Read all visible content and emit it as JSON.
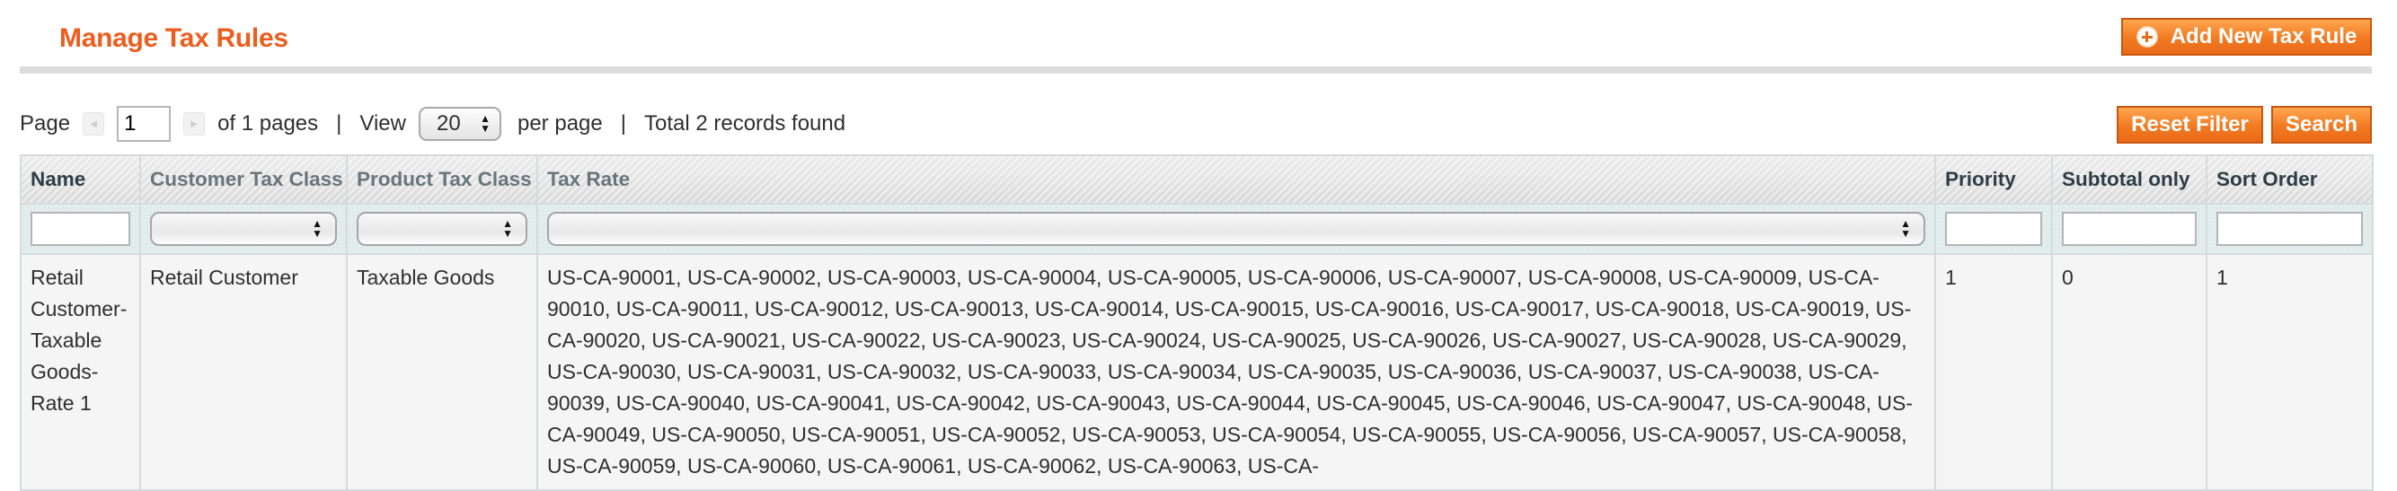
{
  "header": {
    "title": "Manage Tax Rules",
    "add_button_label": "Add New Tax Rule"
  },
  "pager": {
    "page_label": "Page",
    "current_page": "1",
    "of_pages_label": "of 1 pages",
    "separator": "|",
    "view_label": "View",
    "per_page_value": "20",
    "per_page_label": "per page",
    "total_label": "Total 2 records found"
  },
  "actions": {
    "reset_filter_label": "Reset Filter",
    "search_label": "Search"
  },
  "table": {
    "columns": [
      {
        "label": "Name",
        "sorted": true
      },
      {
        "label": "Customer Tax Class",
        "sorted": false
      },
      {
        "label": "Product Tax Class",
        "sorted": false
      },
      {
        "label": "Tax Rate",
        "sorted": false
      },
      {
        "label": "Priority",
        "sorted": true
      },
      {
        "label": "Subtotal only",
        "sorted": true
      },
      {
        "label": "Sort Order",
        "sorted": true
      }
    ],
    "filters": {
      "name": "",
      "customer_tax_class": "",
      "product_tax_class": "",
      "tax_rate": "",
      "priority": "",
      "subtotal_only": "",
      "sort_order": ""
    },
    "rows": [
      {
        "name": "Retail Customer-Taxable Goods-Rate 1",
        "customer_tax_class": "Retail Customer",
        "product_tax_class": "Taxable Goods",
        "tax_rate": "US-CA-90001, US-CA-90002, US-CA-90003, US-CA-90004, US-CA-90005, US-CA-90006, US-CA-90007, US-CA-90008, US-CA-90009, US-CA-90010, US-CA-90011, US-CA-90012, US-CA-90013, US-CA-90014, US-CA-90015, US-CA-90016, US-CA-90017, US-CA-90018, US-CA-90019, US-CA-90020, US-CA-90021, US-CA-90022, US-CA-90023, US-CA-90024, US-CA-90025, US-CA-90026, US-CA-90027, US-CA-90028, US-CA-90029, US-CA-90030, US-CA-90031, US-CA-90032, US-CA-90033, US-CA-90034, US-CA-90035, US-CA-90036, US-CA-90037, US-CA-90038, US-CA-90039, US-CA-90040, US-CA-90041, US-CA-90042, US-CA-90043, US-CA-90044, US-CA-90045, US-CA-90046, US-CA-90047, US-CA-90048, US-CA-90049, US-CA-90050, US-CA-90051, US-CA-90052, US-CA-90053, US-CA-90054, US-CA-90055, US-CA-90056, US-CA-90057, US-CA-90058, US-CA-90059, US-CA-90060, US-CA-90061, US-CA-90062, US-CA-90063, US-CA-",
        "priority": "1",
        "subtotal_only": "0",
        "sort_order": "1"
      }
    ]
  }
}
